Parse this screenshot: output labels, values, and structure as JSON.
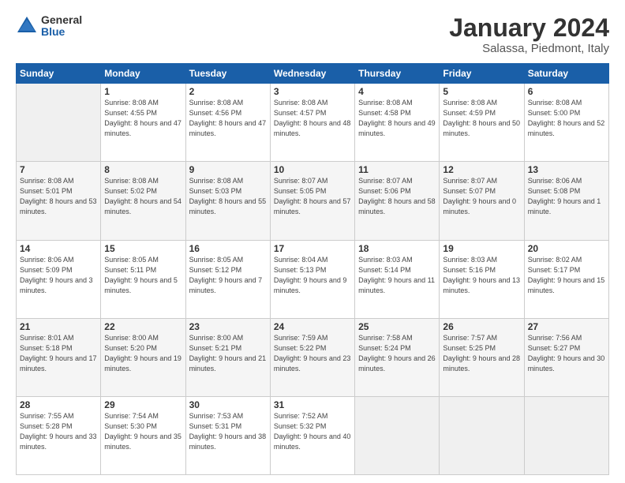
{
  "header": {
    "logo": {
      "general": "General",
      "blue": "Blue"
    },
    "title": "January 2024",
    "location": "Salassa, Piedmont, Italy"
  },
  "weekdays": [
    "Sunday",
    "Monday",
    "Tuesday",
    "Wednesday",
    "Thursday",
    "Friday",
    "Saturday"
  ],
  "weeks": [
    [
      {
        "day": "",
        "empty": true
      },
      {
        "day": "1",
        "sunrise": "8:08 AM",
        "sunset": "4:55 PM",
        "daylight": "8 hours and 47 minutes."
      },
      {
        "day": "2",
        "sunrise": "8:08 AM",
        "sunset": "4:56 PM",
        "daylight": "8 hours and 47 minutes."
      },
      {
        "day": "3",
        "sunrise": "8:08 AM",
        "sunset": "4:57 PM",
        "daylight": "8 hours and 48 minutes."
      },
      {
        "day": "4",
        "sunrise": "8:08 AM",
        "sunset": "4:58 PM",
        "daylight": "8 hours and 49 minutes."
      },
      {
        "day": "5",
        "sunrise": "8:08 AM",
        "sunset": "4:59 PM",
        "daylight": "8 hours and 50 minutes."
      },
      {
        "day": "6",
        "sunrise": "8:08 AM",
        "sunset": "5:00 PM",
        "daylight": "8 hours and 52 minutes."
      }
    ],
    [
      {
        "day": "7",
        "sunrise": "8:08 AM",
        "sunset": "5:01 PM",
        "daylight": "8 hours and 53 minutes."
      },
      {
        "day": "8",
        "sunrise": "8:08 AM",
        "sunset": "5:02 PM",
        "daylight": "8 hours and 54 minutes."
      },
      {
        "day": "9",
        "sunrise": "8:08 AM",
        "sunset": "5:03 PM",
        "daylight": "8 hours and 55 minutes."
      },
      {
        "day": "10",
        "sunrise": "8:07 AM",
        "sunset": "5:05 PM",
        "daylight": "8 hours and 57 minutes."
      },
      {
        "day": "11",
        "sunrise": "8:07 AM",
        "sunset": "5:06 PM",
        "daylight": "8 hours and 58 minutes."
      },
      {
        "day": "12",
        "sunrise": "8:07 AM",
        "sunset": "5:07 PM",
        "daylight": "9 hours and 0 minutes."
      },
      {
        "day": "13",
        "sunrise": "8:06 AM",
        "sunset": "5:08 PM",
        "daylight": "9 hours and 1 minute."
      }
    ],
    [
      {
        "day": "14",
        "sunrise": "8:06 AM",
        "sunset": "5:09 PM",
        "daylight": "9 hours and 3 minutes."
      },
      {
        "day": "15",
        "sunrise": "8:05 AM",
        "sunset": "5:11 PM",
        "daylight": "9 hours and 5 minutes."
      },
      {
        "day": "16",
        "sunrise": "8:05 AM",
        "sunset": "5:12 PM",
        "daylight": "9 hours and 7 minutes."
      },
      {
        "day": "17",
        "sunrise": "8:04 AM",
        "sunset": "5:13 PM",
        "daylight": "9 hours and 9 minutes."
      },
      {
        "day": "18",
        "sunrise": "8:03 AM",
        "sunset": "5:14 PM",
        "daylight": "9 hours and 11 minutes."
      },
      {
        "day": "19",
        "sunrise": "8:03 AM",
        "sunset": "5:16 PM",
        "daylight": "9 hours and 13 minutes."
      },
      {
        "day": "20",
        "sunrise": "8:02 AM",
        "sunset": "5:17 PM",
        "daylight": "9 hours and 15 minutes."
      }
    ],
    [
      {
        "day": "21",
        "sunrise": "8:01 AM",
        "sunset": "5:18 PM",
        "daylight": "9 hours and 17 minutes."
      },
      {
        "day": "22",
        "sunrise": "8:00 AM",
        "sunset": "5:20 PM",
        "daylight": "9 hours and 19 minutes."
      },
      {
        "day": "23",
        "sunrise": "8:00 AM",
        "sunset": "5:21 PM",
        "daylight": "9 hours and 21 minutes."
      },
      {
        "day": "24",
        "sunrise": "7:59 AM",
        "sunset": "5:22 PM",
        "daylight": "9 hours and 23 minutes."
      },
      {
        "day": "25",
        "sunrise": "7:58 AM",
        "sunset": "5:24 PM",
        "daylight": "9 hours and 26 minutes."
      },
      {
        "day": "26",
        "sunrise": "7:57 AM",
        "sunset": "5:25 PM",
        "daylight": "9 hours and 28 minutes."
      },
      {
        "day": "27",
        "sunrise": "7:56 AM",
        "sunset": "5:27 PM",
        "daylight": "9 hours and 30 minutes."
      }
    ],
    [
      {
        "day": "28",
        "sunrise": "7:55 AM",
        "sunset": "5:28 PM",
        "daylight": "9 hours and 33 minutes."
      },
      {
        "day": "29",
        "sunrise": "7:54 AM",
        "sunset": "5:30 PM",
        "daylight": "9 hours and 35 minutes."
      },
      {
        "day": "30",
        "sunrise": "7:53 AM",
        "sunset": "5:31 PM",
        "daylight": "9 hours and 38 minutes."
      },
      {
        "day": "31",
        "sunrise": "7:52 AM",
        "sunset": "5:32 PM",
        "daylight": "9 hours and 40 minutes."
      },
      {
        "day": "",
        "empty": true
      },
      {
        "day": "",
        "empty": true
      },
      {
        "day": "",
        "empty": true
      }
    ]
  ]
}
